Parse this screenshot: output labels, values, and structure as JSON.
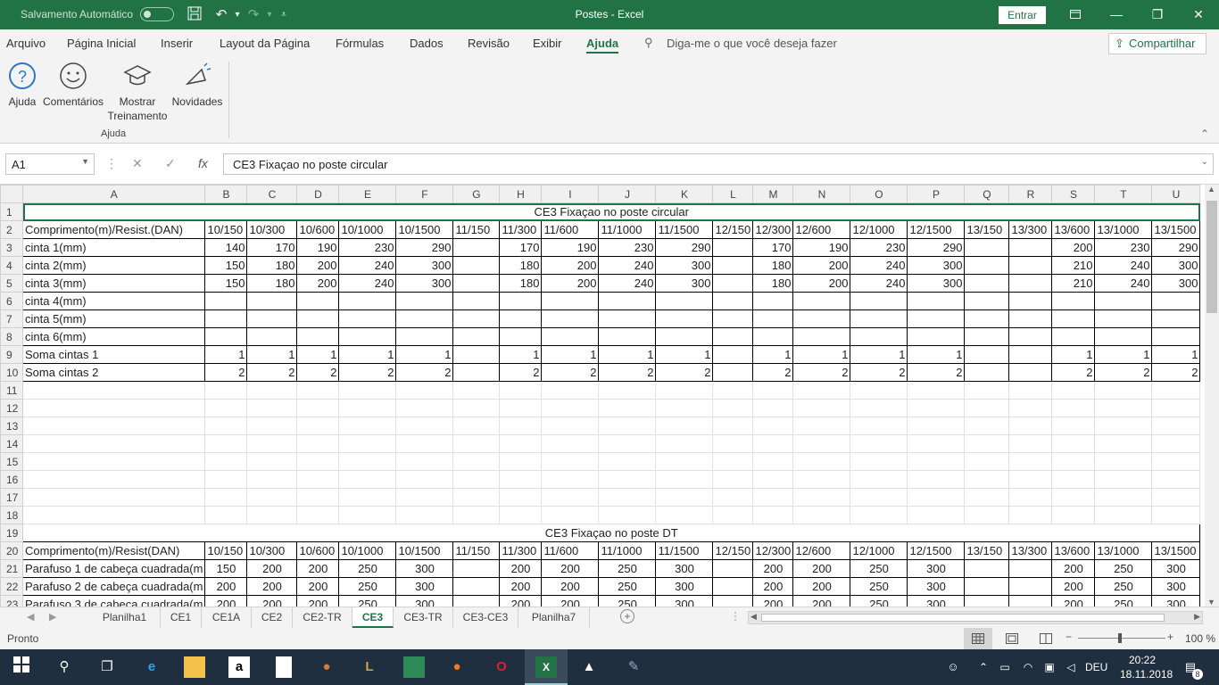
{
  "window": {
    "autosave_label": "Salvamento Automático",
    "doc_title": "Postes - Excel",
    "signin_label": "Entrar"
  },
  "menu": {
    "items": [
      "Arquivo",
      "Página Inicial",
      "Inserir",
      "Layout da Página",
      "Fórmulas",
      "Dados",
      "Revisão",
      "Exibir",
      "Ajuda"
    ],
    "active": "Ajuda",
    "tell_me": "Diga-me o que você deseja fazer",
    "share": "Compartilhar"
  },
  "ribbon": {
    "help": "Ajuda",
    "feedback": "Comentários",
    "training_1": "Mostrar",
    "training_2": "Treinamento",
    "whats_new": "Novidades",
    "group_label": "Ajuda"
  },
  "formula_bar": {
    "name_box": "A1",
    "fx": "fx",
    "content": "CE3 Fixaçao no poste circular"
  },
  "sheet": {
    "columns": [
      "A",
      "B",
      "C",
      "D",
      "E",
      "F",
      "G",
      "H",
      "I",
      "J",
      "K",
      "L",
      "M",
      "N",
      "O",
      "P",
      "Q",
      "R",
      "S",
      "T",
      "U"
    ],
    "rows": [
      [
        "1",
        "CE3 Fixaçao no poste circular"
      ],
      [
        "2",
        "Comprimento(m)/Resist.(DAN)",
        "10/150",
        "10/300",
        "10/600",
        "10/1000",
        "10/1500",
        "11/150",
        "11/300",
        "11/600",
        "11/1000",
        "11/1500",
        "12/150",
        "12/300",
        "12/600",
        "12/1000",
        "12/1500",
        "13/150",
        "13/300",
        "13/600",
        "13/1000",
        "13/1500"
      ],
      [
        "3",
        "cinta 1(mm)",
        "140",
        "170",
        "190",
        "230",
        "290",
        "",
        "170",
        "190",
        "230",
        "290",
        "",
        "170",
        "190",
        "230",
        "290",
        "",
        "",
        "200",
        "230",
        "290"
      ],
      [
        "4",
        "cinta 2(mm)",
        "150",
        "180",
        "200",
        "240",
        "300",
        "",
        "180",
        "200",
        "240",
        "300",
        "",
        "180",
        "200",
        "240",
        "300",
        "",
        "",
        "210",
        "240",
        "300"
      ],
      [
        "5",
        "cinta 3(mm)",
        "150",
        "180",
        "200",
        "240",
        "300",
        "",
        "180",
        "200",
        "240",
        "300",
        "",
        "180",
        "200",
        "240",
        "300",
        "",
        "",
        "210",
        "240",
        "300"
      ],
      [
        "6",
        "cinta 4(mm)",
        "",
        "",
        "",
        "",
        "",
        "",
        "",
        "",
        "",
        "",
        "",
        "",
        "",
        "",
        "",
        "",
        "",
        "",
        "",
        ""
      ],
      [
        "7",
        "cinta 5(mm)",
        "",
        "",
        "",
        "",
        "",
        "",
        "",
        "",
        "",
        "",
        "",
        "",
        "",
        "",
        "",
        "",
        "",
        "",
        "",
        ""
      ],
      [
        "8",
        "cinta 6(mm)",
        "",
        "",
        "",
        "",
        "",
        "",
        "",
        "",
        "",
        "",
        "",
        "",
        "",
        "",
        "",
        "",
        "",
        "",
        "",
        ""
      ],
      [
        "9",
        "Soma cintas 1",
        "1",
        "1",
        "1",
        "1",
        "1",
        "",
        "1",
        "1",
        "1",
        "1",
        "",
        "1",
        "1",
        "1",
        "1",
        "",
        "",
        "1",
        "1",
        "1"
      ],
      [
        "10",
        "Soma cintas 2",
        "2",
        "2",
        "2",
        "2",
        "2",
        "",
        "2",
        "2",
        "2",
        "2",
        "",
        "2",
        "2",
        "2",
        "2",
        "",
        "",
        "2",
        "2",
        "2"
      ],
      [
        "11"
      ],
      [
        "12"
      ],
      [
        "13"
      ],
      [
        "14"
      ],
      [
        "15"
      ],
      [
        "16"
      ],
      [
        "17"
      ],
      [
        "18"
      ],
      [
        "19",
        "CE3 Fixaçao no poste  DT"
      ],
      [
        "20",
        "Comprimento(m)/Resist(DAN)",
        "10/150",
        "10/300",
        "10/600",
        "10/1000",
        "10/1500",
        "11/150",
        "11/300",
        "11/600",
        "11/1000",
        "11/1500",
        "12/150",
        "12/300",
        "12/600",
        "12/1000",
        "12/1500",
        "13/150",
        "13/300",
        "13/600",
        "13/1000",
        "13/1500"
      ],
      [
        "21",
        "Parafuso 1 de cabeça cuadrada(m",
        "150",
        "200",
        "200",
        "250",
        "300",
        "",
        "200",
        "200",
        "250",
        "300",
        "",
        "200",
        "200",
        "250",
        "300",
        "",
        "",
        "200",
        "250",
        "300"
      ],
      [
        "22",
        "Parafuso 2 de cabeça cuadrada(m",
        "200",
        "200",
        "200",
        "250",
        "300",
        "",
        "200",
        "200",
        "250",
        "300",
        "",
        "200",
        "200",
        "250",
        "300",
        "",
        "",
        "200",
        "250",
        "300"
      ],
      [
        "23",
        "Parafuso 3 de cabeça cuadrada(m",
        "200",
        "200",
        "200",
        "250",
        "300",
        "",
        "200",
        "200",
        "250",
        "300",
        "",
        "200",
        "200",
        "250",
        "300",
        "",
        "",
        "200",
        "250",
        "300"
      ]
    ]
  },
  "tabs": {
    "sheets": [
      "Planilha1",
      "CE1",
      "CE1A",
      "CE2",
      "CE2-TR",
      "CE3",
      "CE3-TR",
      "CE3-CE3",
      "Planilha7"
    ],
    "active": "CE3"
  },
  "status": {
    "ready": "Pronto",
    "zoom": "100 %"
  },
  "taskbar": {
    "lang": "DEU",
    "time": "20:22",
    "date": "18.11.2018",
    "notifications": "8"
  },
  "colors": {
    "accent": "#217346",
    "taskbar": "#1f2f3f"
  }
}
